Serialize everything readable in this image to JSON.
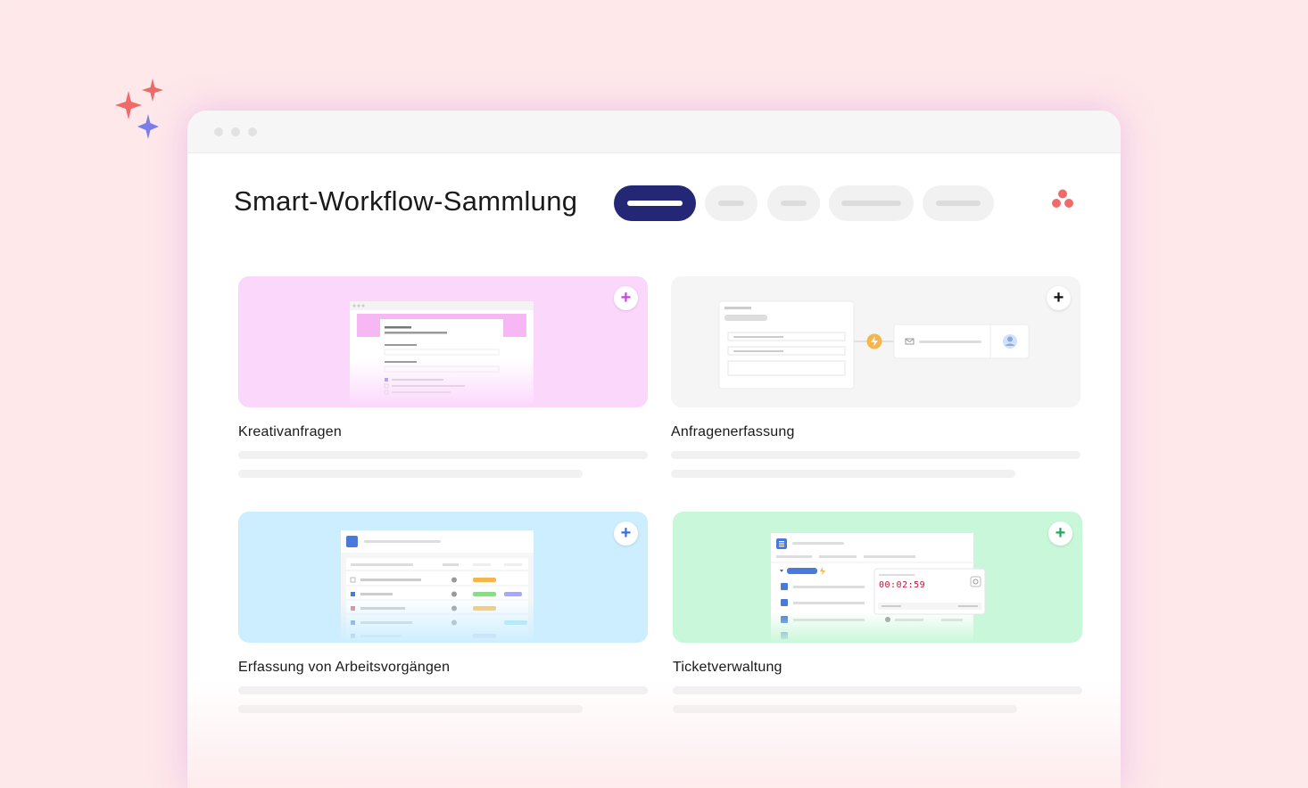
{
  "header": {
    "title": "Smart-Workflow-Sammlung"
  },
  "icons": {
    "sparkles": "sparkles-icon",
    "logo": "asana-logo-icon",
    "plus": "plus-icon"
  },
  "colors": {
    "active_tab": "#232775",
    "logo": "#f06a6a",
    "card_pink": "#fcd7fc",
    "card_gray": "#f5f5f5",
    "card_blue": "#cdeeff",
    "card_green": "#c9f7d9"
  },
  "cards": [
    {
      "title": "Kreativanfragen"
    },
    {
      "title": "Anfragenerfassung"
    },
    {
      "title": "Erfassung von Arbeitsvorgängen"
    },
    {
      "title": "Ticketverwaltung",
      "timer": "00:02:59"
    }
  ]
}
